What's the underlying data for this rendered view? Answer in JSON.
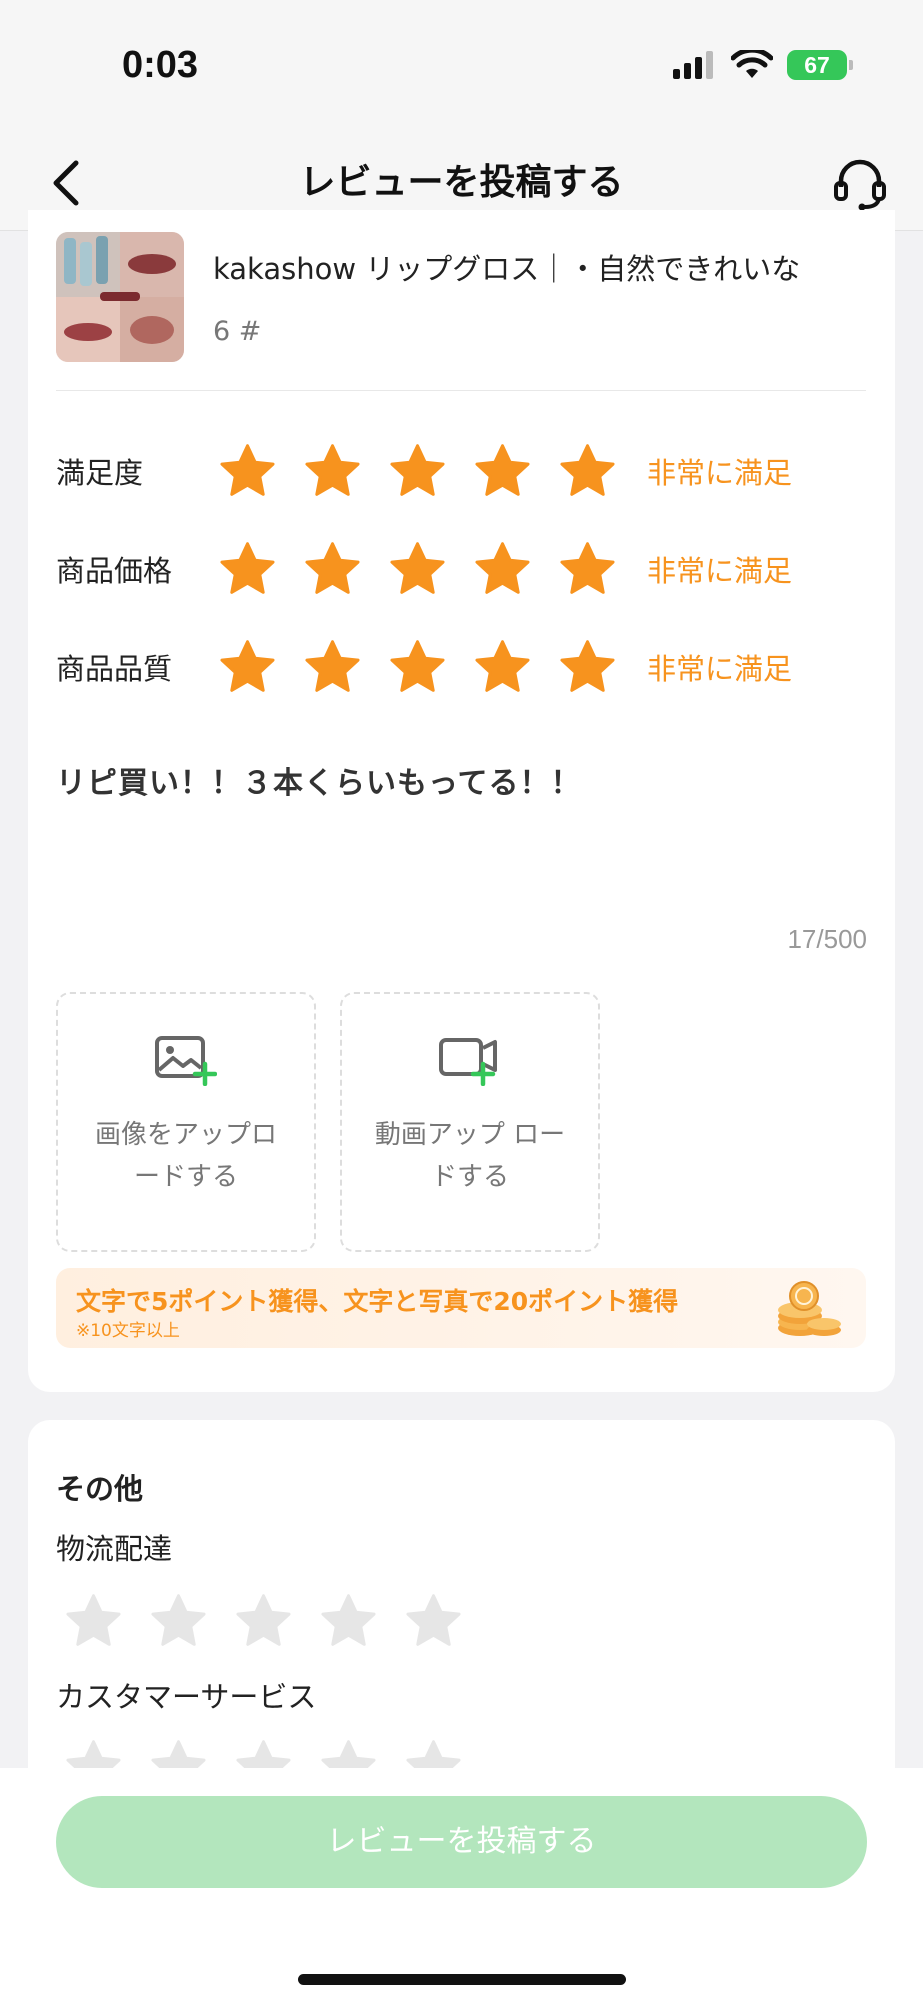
{
  "status": {
    "time": "0:03",
    "battery": "67"
  },
  "nav": {
    "title": "レビューを投稿する",
    "back_icon": "chevron-left-icon",
    "support_icon": "headset-icon"
  },
  "product": {
    "name": "kakashow リップグロス｜・自然できれいな",
    "variant": "6 #"
  },
  "ratings": [
    {
      "label": "満足度",
      "stars": 5,
      "status": "非常に満足"
    },
    {
      "label": "商品価格",
      "stars": 5,
      "status": "非常に満足"
    },
    {
      "label": "商品品質",
      "stars": 5,
      "status": "非常に満足"
    }
  ],
  "review": {
    "text": "リピ買い！！３本くらいもってる！！",
    "char_count": "17/500"
  },
  "upload": {
    "image_label": "画像をアップロードする",
    "video_label": "動画アップ ロードする"
  },
  "points": {
    "main": "文字で5ポイント獲得、文字と写真で20ポイント獲得",
    "sub": "※10文字以上"
  },
  "other": {
    "title": "その他",
    "items": [
      {
        "label": "物流配達",
        "stars": 0
      },
      {
        "label": "カスタマーサービス",
        "stars": 0
      }
    ]
  },
  "submit": {
    "label": "レビューを投稿する"
  },
  "colors": {
    "accent": "#f7931e",
    "star_empty": "#e6e6e6",
    "submit_disabled": "#b3e6bd",
    "battery": "#35c759"
  }
}
